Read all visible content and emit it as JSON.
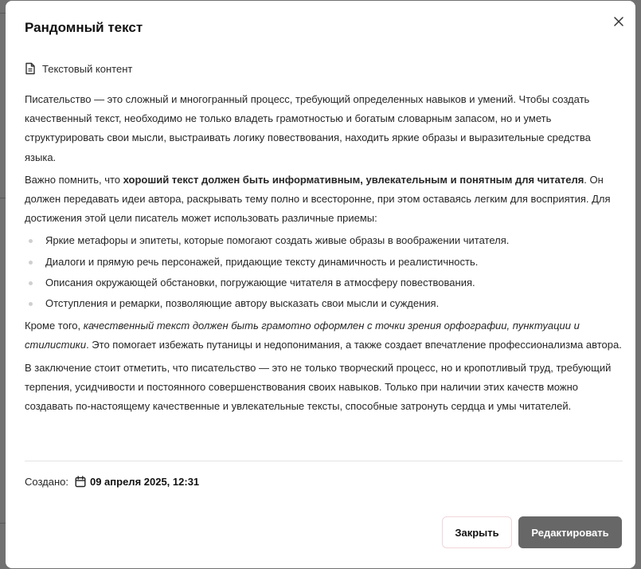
{
  "modal": {
    "title": "Рандомный текст",
    "section_label": "Текстовый контент",
    "paragraph1": "Писательство — это сложный и многогранный процесс, требующий определенных навыков и умений. Чтобы создать качественный текст, необходимо не только владеть грамотностью и богатым словарным запасом, но и уметь структурировать свои мысли, выстраивать логику повествования, находить яркие образы и выразительные средства языка.",
    "paragraph2": {
      "before": "Важно помнить, что ",
      "bold": "хороший текст должен быть информативным, увлекательным и понятным для читателя",
      "after": ". Он должен передавать идеи автора, раскрывать тему полно и всесторонне, при этом оставаясь легким для восприятия. Для достижения этой цели писатель может использовать различные приемы:"
    },
    "list_items": [
      "Яркие метафоры и эпитеты, которые помогают создать живые образы в воображении читателя.",
      "Диалоги и прямую речь персонажей, придающие тексту динамичность и реалистичность.",
      "Описания окружающей обстановки, погружающие читателя в атмосферу повествования.",
      "Отступления и ремарки, позволяющие автору высказать свои мысли и суждения."
    ],
    "paragraph3": {
      "before": "Кроме того, ",
      "italic": "качественный текст должен быть грамотно оформлен с точки зрения орфографии, пунктуации и стилистики",
      "after": ". Это помогает избежать путаницы и недопонимания, а также создает впечатление профессионализма автора."
    },
    "paragraph4": "В заключение стоит отметить, что писательство — это не только творческий процесс, но и кропотливый труд, требующий терпения, усидчивости и постоянного совершенствования своих навыков. Только при наличии этих качеств можно создавать по-настоящему качественные и увлекательные тексты, способные затронуть сердца и умы читателей.",
    "created_label": "Создано:",
    "created_date": "09 апреля 2025, 12:31",
    "close_button": "Закрыть",
    "edit_button": "Редактировать"
  },
  "icons": {
    "close": "close-icon",
    "document": "document-icon",
    "calendar": "calendar-icon"
  },
  "colors": {
    "overlay": "#717171",
    "primary_button": "#676767",
    "close_button_border": "#f1d5d9"
  }
}
